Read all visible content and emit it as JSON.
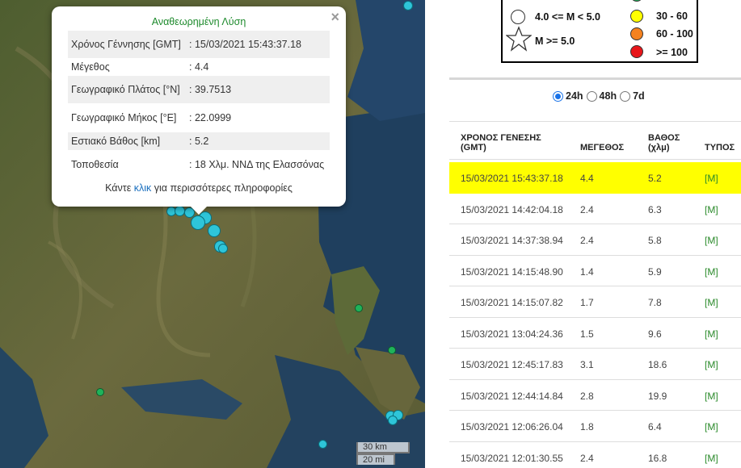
{
  "popup": {
    "title": "Αναθεωρημένη Λύση",
    "close": "×",
    "fields": [
      {
        "label": "Χρόνος Γέννησης [GMT]",
        "value": ": 15/03/2021 15:43:37.18"
      },
      {
        "label": "Μέγεθος",
        "value": ": 4.4"
      },
      {
        "label": "Γεωγραφικό Πλάτος [°N]",
        "value": ": 39.7513"
      },
      {
        "label": "Γεωγραφικό Μήκος [°E]",
        "value": ": 22.0999"
      },
      {
        "label": "Εστιακό Βάθος [km]",
        "value": ": 5.2"
      },
      {
        "label": "Τοποθεσία",
        "value": ": 18 Χλμ. ΝΝΔ της Ελασσόνας"
      }
    ],
    "more_pre": "Κάντε ",
    "more_link": "κλικ",
    "more_post": " για περισσότερες πληροφορίες"
  },
  "scale": {
    "km": "30 km",
    "mi": "20 mi"
  },
  "legend": {
    "mag_mid": "4.0 <= M < 5.0",
    "mag_high": "M >= 5.0",
    "depth_1": "30 - 60",
    "depth_2": "60 - 100",
    "depth_3": ">= 100",
    "colors": {
      "green": "#1fb35a",
      "yellow": "#ffff00",
      "orange": "#f5821f",
      "red": "#e8161b"
    }
  },
  "filters": {
    "options": [
      "24h",
      "48h",
      "7d"
    ],
    "selected": "24h"
  },
  "table": {
    "headers": {
      "time": "ΧΡΟΝΟΣ ΓΕΝΕΣΗΣ",
      "time_unit": "(GMT)",
      "mag": "ΜΕΓΕΘΟΣ",
      "depth": "ΒΑΘΟΣ",
      "depth_unit": "(χλμ)",
      "type": "ΤΥΠΟΣ"
    },
    "rows": [
      {
        "time": "15/03/2021 15:43:37.18",
        "mag": "4.4",
        "depth": "5.2",
        "type": "[M]"
      },
      {
        "time": "15/03/2021 14:42:04.18",
        "mag": "2.4",
        "depth": "6.3",
        "type": "[M]"
      },
      {
        "time": "15/03/2021 14:37:38.94",
        "mag": "2.4",
        "depth": "5.8",
        "type": "[M]"
      },
      {
        "time": "15/03/2021 14:15:48.90",
        "mag": "1.4",
        "depth": "5.9",
        "type": "[M]"
      },
      {
        "time": "15/03/2021 14:15:07.82",
        "mag": "1.7",
        "depth": "7.8",
        "type": "[M]"
      },
      {
        "time": "15/03/2021 13:04:24.36",
        "mag": "1.5",
        "depth": "9.6",
        "type": "[M]"
      },
      {
        "time": "15/03/2021 12:45:17.83",
        "mag": "3.1",
        "depth": "18.6",
        "type": "[M]"
      },
      {
        "time": "15/03/2021 12:44:14.84",
        "mag": "2.8",
        "depth": "19.9",
        "type": "[M]"
      },
      {
        "time": "15/03/2021 12:06:26.04",
        "mag": "1.8",
        "depth": "6.4",
        "type": "[M]"
      },
      {
        "time": "15/03/2021 12:01:30.55",
        "mag": "2.4",
        "depth": "16.8",
        "type": "[M]"
      }
    ]
  }
}
